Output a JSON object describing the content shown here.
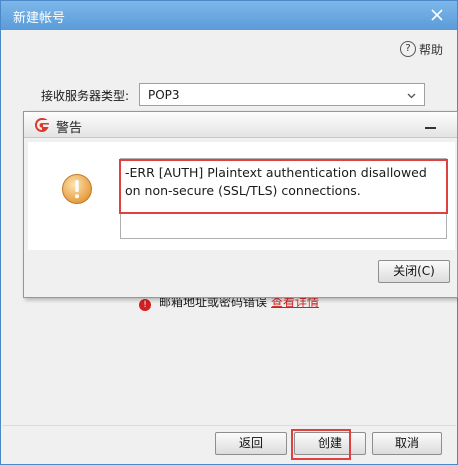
{
  "window": {
    "title": "新建帐号",
    "help_label": "帮助",
    "help_glyph": "?",
    "server_type_label": "接收服务器类型:",
    "server_type_value": "POP3",
    "error_text": "邮箱地址或密码错误",
    "error_link": "查看详情",
    "buttons": {
      "back": "返回",
      "create": "创建",
      "cancel": "取消"
    }
  },
  "alert": {
    "title": "警告",
    "message": "-ERR [AUTH] Plaintext authentication disallowed on non-secure (SSL/TLS) connections.",
    "close_label": "关闭(C)"
  },
  "colors": {
    "title_bar": "#5a9bd8",
    "highlight": "#e04040",
    "warning_icon": "#e8a040",
    "error_icon": "#d02020",
    "logo": "#d93a2b"
  },
  "icons": [
    "close-icon",
    "help-icon",
    "chevron-down-icon",
    "foxmail-logo-icon",
    "minimize-icon",
    "warning-icon",
    "error-icon"
  ]
}
